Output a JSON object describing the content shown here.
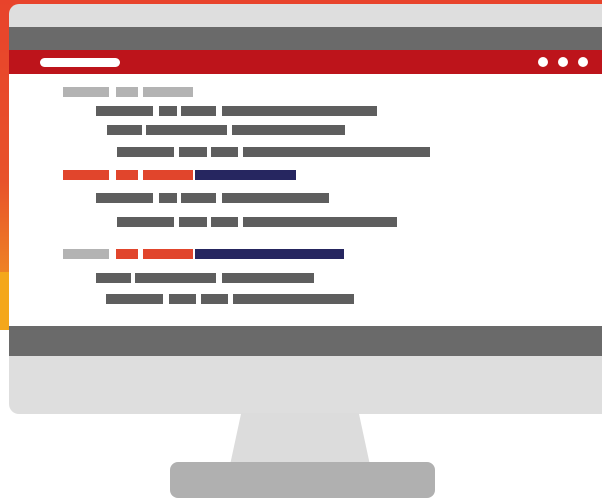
{
  "colors": {
    "background_orange": "#e8432b",
    "accent_yellow": "#f4a71b",
    "browser_bar_red": "#bd141b",
    "monitor_gray": "#dedede",
    "dark_gray_bar": "#6a6a6a",
    "code_dark_gray": "#5e5e5e",
    "code_light_gray": "#b3b3b3",
    "code_red": "#e1452c",
    "code_navy": "#262660",
    "stand_gray": "#dcdcdc",
    "base_gray": "#b0b0b0"
  },
  "icons": {
    "window_dots": [
      "window-dot-icon",
      "window-dot-icon",
      "window-dot-icon"
    ],
    "address_bar": "address-bar-pill"
  }
}
